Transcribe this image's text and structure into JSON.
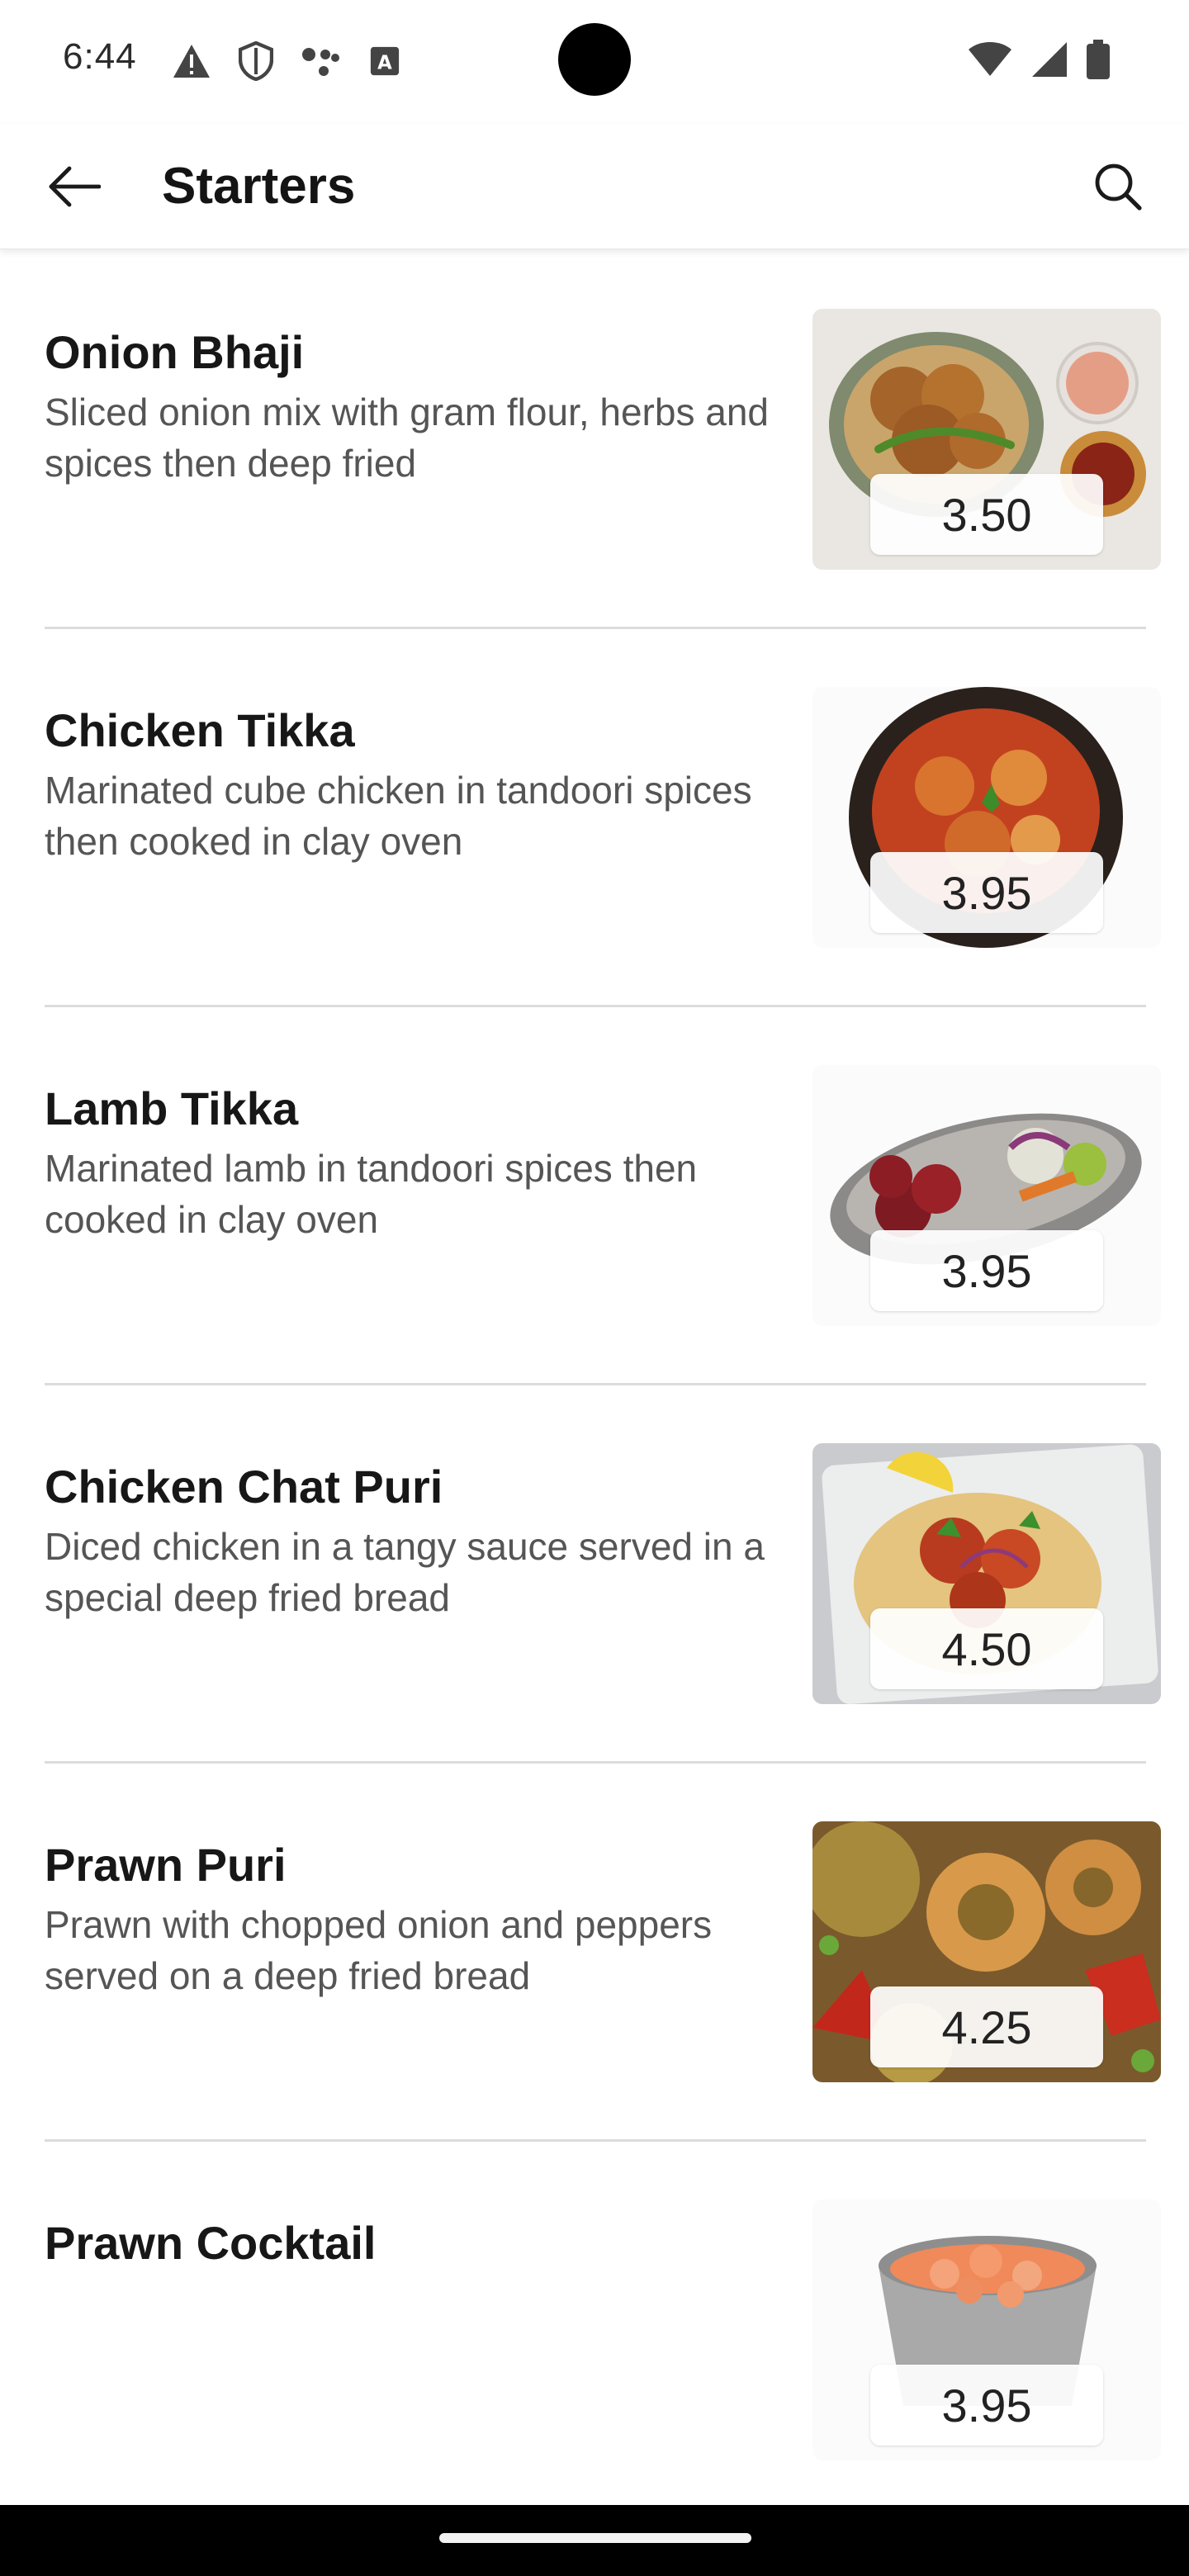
{
  "status_bar": {
    "time": "6:44",
    "left_icons": [
      "warning-icon",
      "shield-icon",
      "assistant-icon",
      "keyboard-icon"
    ],
    "right_icons": [
      "wifi-icon",
      "signal-icon",
      "battery-icon"
    ]
  },
  "app_bar": {
    "title": "Starters",
    "back_icon": "arrow-left-icon",
    "search_icon": "search-icon"
  },
  "menu": {
    "items": [
      {
        "name": "Onion Bhaji",
        "description": "Sliced onion mix with gram flour, herbs and spices then deep fried",
        "price": "3.50",
        "image": "onion-bhaji-photo"
      },
      {
        "name": "Chicken Tikka",
        "description": "Marinated cube chicken in tandoori spices then cooked in clay oven",
        "price": "3.95",
        "image": "chicken-tikka-photo"
      },
      {
        "name": "Lamb Tikka",
        "description": "Marinated lamb in tandoori spices then cooked in clay oven",
        "price": "3.95",
        "image": "lamb-tikka-photo"
      },
      {
        "name": "Chicken Chat Puri",
        "description": "Diced chicken in a tangy sauce served in a special deep fried bread",
        "price": "4.50",
        "image": "chicken-chat-puri-photo"
      },
      {
        "name": "Prawn Puri",
        "description": "Prawn with chopped onion and peppers served on a deep fried bread",
        "price": "4.25",
        "image": "prawn-puri-photo"
      },
      {
        "name": "Prawn Cocktail",
        "description": "",
        "price": "3.95",
        "image": "prawn-cocktail-photo"
      }
    ]
  },
  "colors": {
    "background": "#ffffff",
    "title_text": "#141414",
    "description_text": "#555555",
    "divider": "#dcdcdc",
    "nav_bar": "#000000"
  }
}
